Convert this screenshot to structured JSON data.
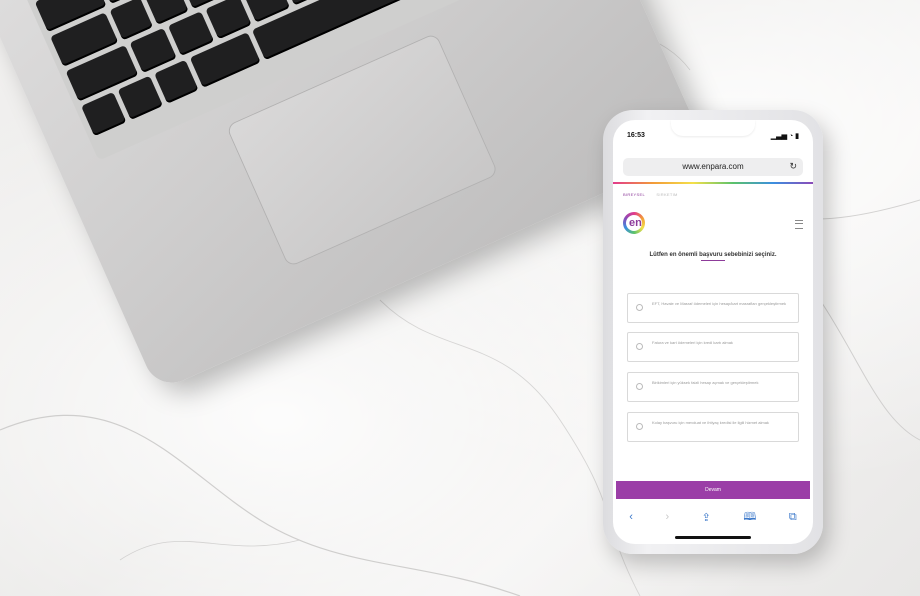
{
  "phone": {
    "status_time": "16:53",
    "status_indicators": "▁▃▅ ◔ ▮",
    "url": "www.enpara.com",
    "reload_icon": "reload-icon",
    "nav_items": [
      "BIREYSEL",
      "SIRKETIM"
    ],
    "logo_text": "en",
    "question": "Lütfen en önemli başvuru sebebinizi seçiniz.",
    "options": [
      "EFT, Havale ve Masraf ödemeleri için hesap/kart masrafları gerçekleştirmek",
      "Fatura ve kart ödemeleri için kredi kartı almak",
      "Birikimleri için yüksek faizli hesap açmak ve gerçekleştirmek",
      "Kolay başvuru için mevduat ve ihtiyaç kredisi ile ilgili hizmet almak"
    ],
    "cta_label": "Devam",
    "toolbar_icons": [
      "back-icon",
      "forward-icon",
      "share-icon",
      "bookmarks-icon",
      "tabs-icon"
    ],
    "accent_color": "#9b3ea7"
  }
}
